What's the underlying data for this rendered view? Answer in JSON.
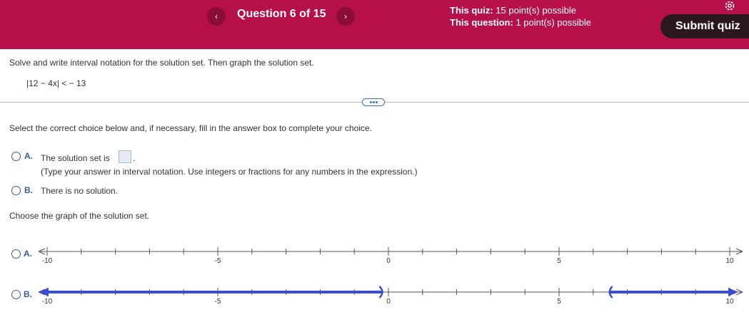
{
  "header": {
    "prev_icon": "‹",
    "question_label": "Question 6 of 15",
    "next_icon": "›",
    "quiz_label": "This quiz:",
    "quiz_value": "15 point(s) possible",
    "question_points_label": "This question:",
    "question_points_value": "1 point(s) possible",
    "submit_label": "Submit quiz",
    "settings_icon": "gear-icon"
  },
  "problem": {
    "instructions": "Solve and write interval notation for the solution set. Then graph the solution set.",
    "expression": "|12 − 4x| < − 13"
  },
  "choice_prompt": "Select the correct choice below and, if necessary, fill in the answer box to complete your choice.",
  "choices": [
    {
      "letter": "A.",
      "text": "The solution set is",
      "hint": "(Type your answer in interval notation. Use integers or fractions for any numbers in the expression.)"
    },
    {
      "letter": "B.",
      "text": "There is no solution."
    }
  ],
  "graph_prompt": "Choose the graph of the solution set.",
  "graph_options": [
    {
      "letter": "A.",
      "tick_labels": [
        "-10",
        "-5",
        "0",
        "5",
        "10"
      ],
      "range": [
        -10,
        10
      ],
      "shaded": []
    },
    {
      "letter": "B.",
      "tick_labels": [
        "-10",
        "-5",
        "0",
        "5",
        "10"
      ],
      "range": [
        -10,
        10
      ],
      "shaded": [
        {
          "from": -10,
          "to": -0.2,
          "left_arrow": true,
          "right_end": "open-paren"
        },
        {
          "from": 6.5,
          "to": 10,
          "left_end": "open-paren",
          "right_arrow": true
        }
      ]
    }
  ],
  "colors": {
    "header_bg": "#b5104a",
    "submit_bg": "#2b1720",
    "shade": "#3b4fcc",
    "radio": "#3d5a94"
  }
}
